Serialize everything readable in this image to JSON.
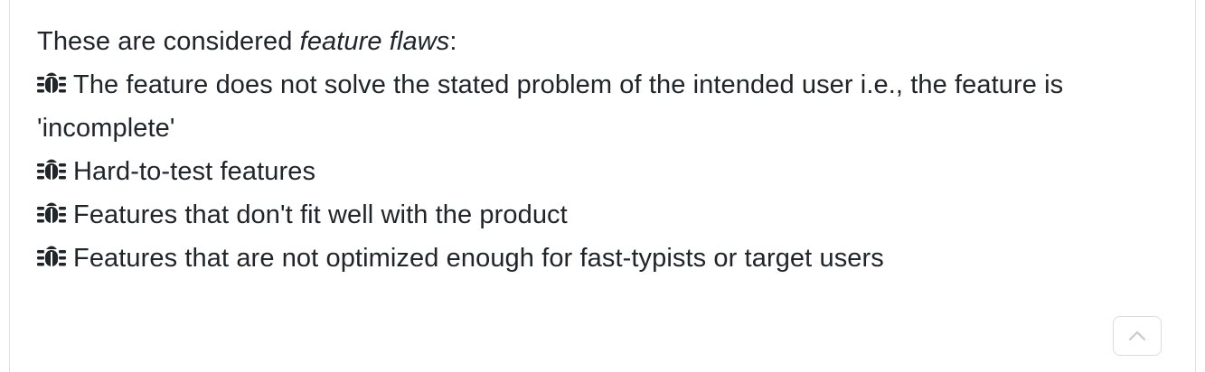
{
  "intro": {
    "text_before": "These are considered ",
    "emphasis": "feature flaws",
    "text_after": ":"
  },
  "flaws": [
    {
      "icon": "bug-icon",
      "text": "The feature does not solve the stated problem of the intended user i.e., the feature is 'incomplete'"
    },
    {
      "icon": "bug-icon",
      "text": "Hard-to-test features"
    },
    {
      "icon": "bug-icon",
      "text": "Features that don't fit well with the product"
    },
    {
      "icon": "bug-icon",
      "text": "Features that are not optimized enough for fast-typists or target users"
    }
  ],
  "scroll_top_button": {
    "icon": "chevron-up-icon"
  },
  "colors": {
    "text": "#212529",
    "border": "#e3e3e3",
    "button_border": "#dcdcdc",
    "chevron": "#c8c8c8"
  }
}
